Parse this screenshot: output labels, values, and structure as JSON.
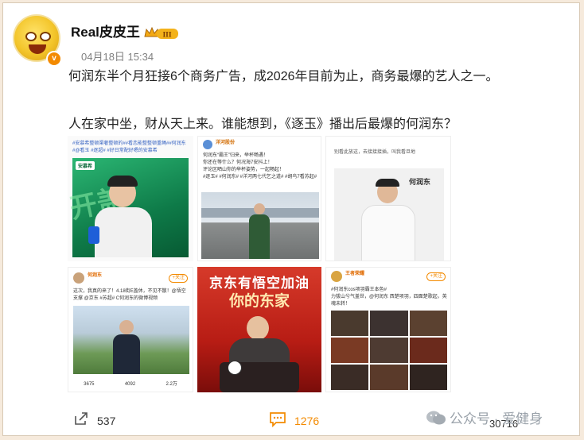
{
  "user": {
    "name": "Real皮皮王",
    "level_badge": "III",
    "verified_mark": "v"
  },
  "post": {
    "timestamp": "04月18日 15:34",
    "text_line1": "何润东半个月狂接6个商务广告，成2026年目前为止，商务最爆的艺人之一。",
    "text_line2": "人在家中坐，财从天上来。谁能想到，《逐玉》播出后最爆的何润东？"
  },
  "images": {
    "img1": {
      "snippet": "#安慕希整顿渠奢整顿的##看恋能整整顿重绳##何润东#@看玉 #逐超# #好日常配好嗯的安慕希",
      "brand": "安慕希"
    },
    "img2": {
      "account": "洋河股份",
      "snippet": "何润东“霸王”归来，举杯畅遇！\n你还在等什么？何况海7安抖上！\n评论区晒山你的举杯姿势，一起畅起！\n#逐玉# #何润东# #洋河两七代乞之道# #胡鸟7看苏起#"
    },
    "img3": {
      "snippet": "别看此放这，去接接接插，叫我看旦地",
      "caption": "何润东"
    },
    "img4": {
      "account": "何润东",
      "follow_label": "+关注",
      "snippet": "这次，我真的来了！4.18街E盖休，不见不散！@悟空支撑 @京东 #苏超# C何润东的微博视频",
      "stats": [
        "3675",
        "4092",
        "2.2万"
      ]
    },
    "img5": {
      "headline1": "京东有悟空加油",
      "headline2": "你的东家"
    },
    "img6": {
      "account": "王者荣耀",
      "follow_label": "+关注",
      "snippet": "#何润东cos项羽霸王本色#\n力拔山兮气盖世，@何润东 西楚项羽，四面楚歌起，英魂未转！"
    }
  },
  "actions": {
    "share_count": "537",
    "comment_count": "1276",
    "like_count": "30716"
  },
  "watermark": "公众号 · 爱健身",
  "colors": {
    "accent": "#f38a00",
    "text": "#222222",
    "muted": "#808080"
  }
}
